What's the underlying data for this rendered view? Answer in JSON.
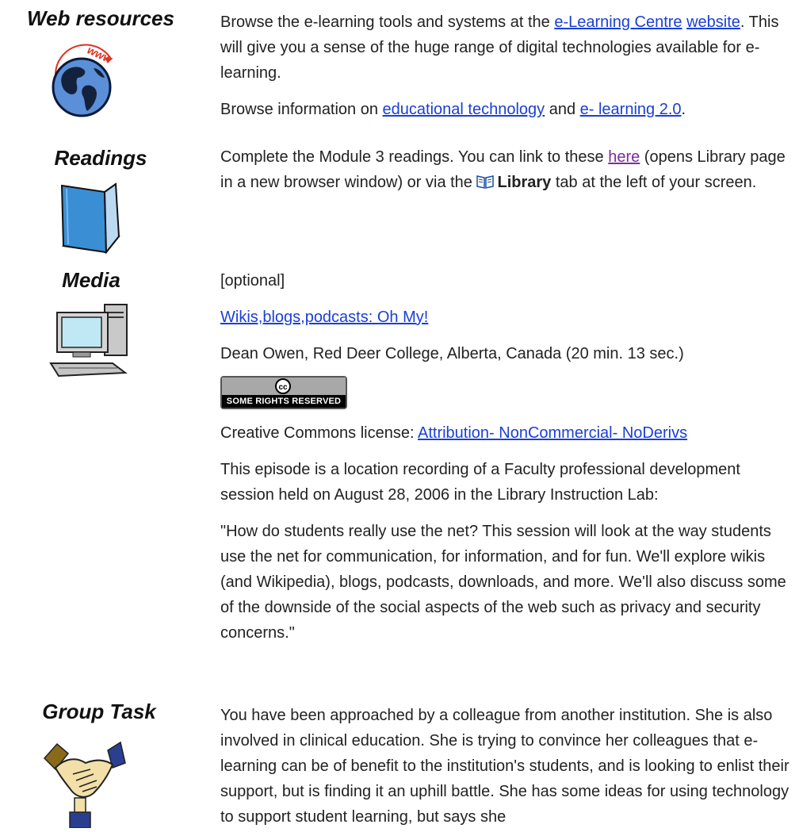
{
  "web_resources": {
    "title": "Web resources",
    "icon": "globe-www-icon",
    "p1_before": "Browse the e-learning tools and systems at the ",
    "p1_link1": "e-Learning Centre",
    "p1_link2": "website",
    "p1_after": ". This will give you a sense of the huge range of digital technologies available for e- learning.",
    "p2_before": "Browse information on ",
    "p2_link1": "educational technology",
    "p2_mid": " and ",
    "p2_link2": "e- learning 2.0",
    "p2_after": "."
  },
  "readings": {
    "title": "Readings",
    "icon": "book-icon",
    "p_before": "Complete the Module 3 readings. You can link to these ",
    "p_link": "here",
    "p_mid": " (opens Library page in a new browser window) or via the ",
    "p_bold": "Library",
    "p_after": " tab at the left of your screen."
  },
  "media": {
    "title": "Media",
    "icon": "computer-icon",
    "optional": "[optional]",
    "video_link": "Wikis,blogs,podcasts: Oh My!",
    "credit": "Dean Owen, Red Deer College, Alberta, Canada (20 min. 13 sec.)",
    "cc_badge_symbol": "cc",
    "cc_badge_text": "SOME RIGHTS RESERVED",
    "license_before": "Creative Commons license: ",
    "license_link": "Attribution- NonCommercial- NoDerivs",
    "episode": "This episode is a location recording of a Faculty professional development session held on August 28, 2006 in the Library Instruction Lab:",
    "quote": "\"How do students really use the net? This session will look at the way students use the net for communication, for information, and for fun. We'll explore wikis (and Wikipedia), blogs, podcasts, downloads, and more. We'll also discuss some of the downside of the social aspects of the web such as privacy and security concerns.\""
  },
  "group_task": {
    "title": "Group Task",
    "icon": "handshake-icon",
    "text": "You have been approached by a colleague from another institution. She is also involved in clinical education. She is trying to convince her colleagues that e-  learning can be of benefit to the institution's students, and is looking to enlist their support, but is finding it an uphill battle. She has some ideas for using technology to support student learning, but says she"
  }
}
